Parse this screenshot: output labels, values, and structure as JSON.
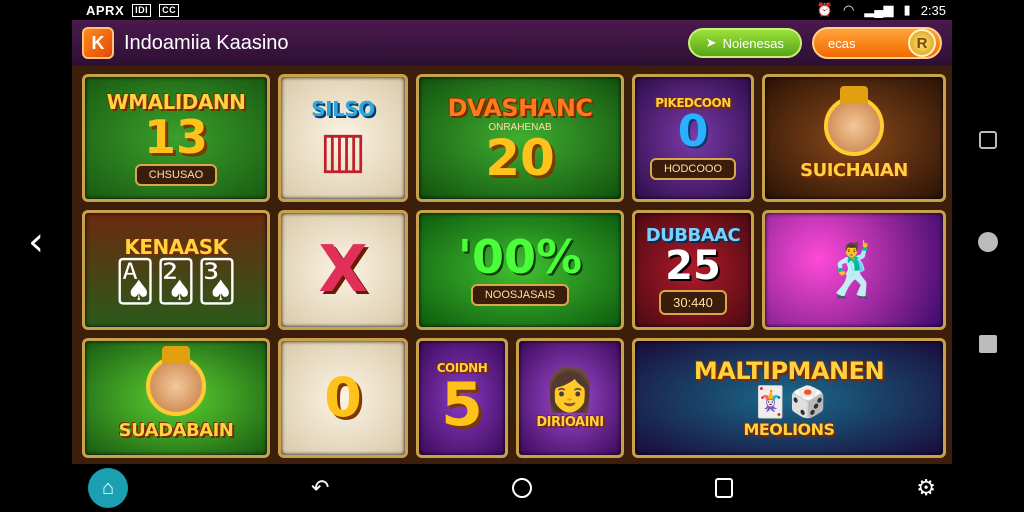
{
  "statusbar": {
    "carrier": "APRX",
    "icon1": "IDI",
    "icon2": "CC",
    "time": "2:35"
  },
  "header": {
    "title": "Indoamiia Kaasino",
    "logo_glyph": "K",
    "green_button": "Noienesas",
    "orange_button": "ecas"
  },
  "tiles": [
    {
      "title": "WMALIDANN",
      "number": "13",
      "pill": "CHSUSAO",
      "bg": "green"
    },
    {
      "title": "SILSO",
      "number": "",
      "pill": "",
      "bg": "cream"
    },
    {
      "title": "DVASHANC",
      "subtitle": "ONRAHENAB",
      "number": "20",
      "pill": "",
      "bg": "green"
    },
    {
      "title": "PIKEDCOON",
      "number": "0",
      "pill": "HODCOOO",
      "bg": "purple"
    },
    {
      "title": "SUICHAIAN",
      "number": "",
      "pill": "",
      "bg": "brown"
    },
    {
      "title": "KENAASK",
      "number": "",
      "pill": "",
      "bg": "casino"
    },
    {
      "title": "X",
      "number": "",
      "pill": "",
      "bg": "cream"
    },
    {
      "title": "",
      "number": "'00%",
      "pill": "NOOSJASAIS",
      "bg": "green"
    },
    {
      "title": "DUBBAAC",
      "number": "25",
      "pill": "30:440",
      "bg": "red"
    },
    {
      "title": "",
      "number": "",
      "pill": "",
      "bg": "violet"
    },
    {
      "title": "SUADABAIN",
      "number": "",
      "pill": "",
      "bg": "green"
    },
    {
      "title": "",
      "number": "0",
      "pill": "",
      "bg": "cream"
    },
    {
      "title": "COIDNH",
      "number": "5",
      "pill": "",
      "bg": "purple"
    },
    {
      "title": "DIRIOAINI",
      "number": "",
      "pill": "",
      "bg": "purple"
    },
    {
      "title": "MALTIPMANEN",
      "number": "",
      "pill": "",
      "subtitle": "MEOLIONS",
      "bg": "teal"
    }
  ],
  "icons": {
    "back": "chevron-left-icon",
    "home": "home-icon",
    "return": "undo-icon",
    "circle": "circle-home-icon",
    "recent": "recent-apps-icon",
    "settings": "gear-icon"
  }
}
